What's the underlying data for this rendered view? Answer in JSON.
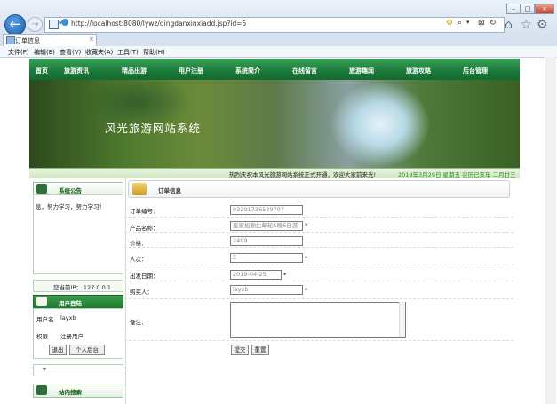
{
  "browser": {
    "address": "http://localhost:8080/lywz/dingdanxinxiadd.jsp?id=5",
    "tab_title": "订单信息",
    "tab_close": "×",
    "back_glyph": "←",
    "forward_glyph": "→",
    "menu": [
      "文件(F)",
      "编辑(E)",
      "查看(V)",
      "收藏夹(A)",
      "工具(T)",
      "帮助(H)"
    ],
    "window_buttons": [
      "–",
      "□",
      "×"
    ],
    "toolbar_glyphs": [
      "⌕",
      "▾",
      "⊠",
      "↻"
    ],
    "right_icons": [
      "home-icon",
      "star-icon",
      "gear-icon"
    ]
  },
  "site": {
    "nav": [
      "首页",
      "旅游资讯",
      "精品出游",
      "用户注册",
      "系统简介",
      "在线留言",
      "旅游趣闻",
      "旅游攻略",
      "后台管理"
    ],
    "banner_title": "风光旅游网站系统",
    "marquee": "热烈庆祝本风光旅游网站系统正式开通，欢迎大家前来光!",
    "date": "2019年3月29日 星期五 农历己亥年 二月廿三"
  },
  "sidebar": {
    "notice_title": "系统公告",
    "notice_text": "息，努力学习，努力学习！",
    "ip_label": "您当前IP：",
    "ip": "127.0.0.1",
    "login_title": "用户登陆",
    "user_label": "用户名",
    "user_value": "layxb",
    "role_label": "权限",
    "role_value": "注册用户",
    "logout_btn": "退出",
    "personal_btn": "个人后台",
    "sep_mark": "+",
    "search_title": "站内搜索"
  },
  "order": {
    "title": "订单信息",
    "fields": [
      {
        "label": "订单编号：",
        "value": "03291736539707",
        "required": false
      },
      {
        "label": "产品名称：",
        "value": "皇家加勒比邮轮5晚6日游",
        "required": true
      },
      {
        "label": "价格：",
        "value": "2499",
        "required": false
      },
      {
        "label": "人次：",
        "value": "5",
        "required": true
      },
      {
        "label": "出发日期：",
        "value": "2019-04-25",
        "required": true
      },
      {
        "label": "购买人：",
        "value": "layxb",
        "required": true
      }
    ],
    "remark_label": "备注：",
    "required_mark": "*",
    "submit": "提交",
    "reset": "重置"
  }
}
